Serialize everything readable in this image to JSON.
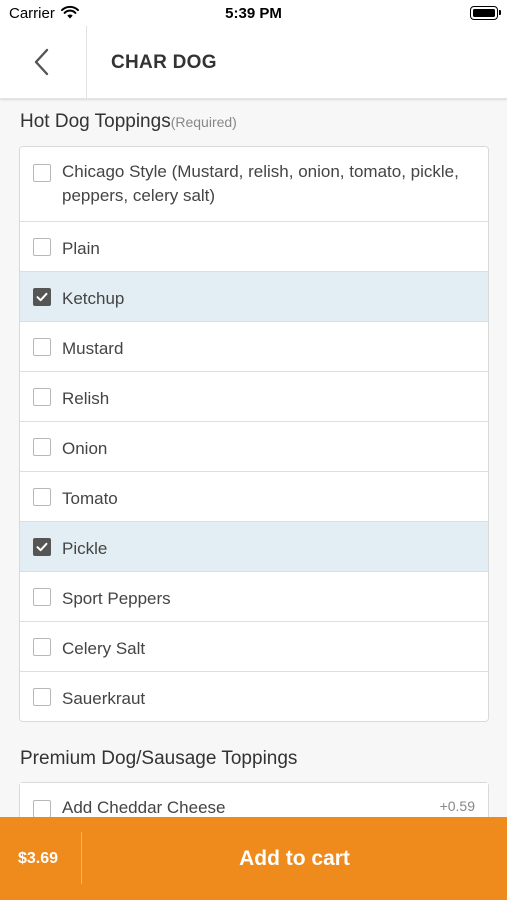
{
  "status_bar": {
    "carrier": "Carrier",
    "time": "5:39 PM"
  },
  "header": {
    "title": "CHAR DOG"
  },
  "sections": {
    "toppings": {
      "title": "Hot Dog Toppings",
      "required": "(Required)",
      "options": [
        {
          "label": "Chicago Style (Mustard, relish, onion, tomato, pickle, peppers, celery salt)",
          "checked": false
        },
        {
          "label": "Plain",
          "checked": false
        },
        {
          "label": "Ketchup",
          "checked": true
        },
        {
          "label": "Mustard",
          "checked": false
        },
        {
          "label": "Relish",
          "checked": false
        },
        {
          "label": "Onion",
          "checked": false
        },
        {
          "label": "Tomato",
          "checked": false
        },
        {
          "label": "Pickle",
          "checked": true
        },
        {
          "label": "Sport Peppers",
          "checked": false
        },
        {
          "label": "Celery Salt",
          "checked": false
        },
        {
          "label": "Sauerkraut",
          "checked": false
        }
      ]
    },
    "premium": {
      "title": "Premium Dog/Sausage Toppings",
      "options": [
        {
          "label": "Add Cheddar Cheese",
          "price": "+0.59",
          "checked": false
        }
      ]
    }
  },
  "cart": {
    "total": "$3.69",
    "button_label": "Add to cart"
  },
  "colors": {
    "accent": "#ef8b1c",
    "selected_row": "#e3eef4"
  }
}
